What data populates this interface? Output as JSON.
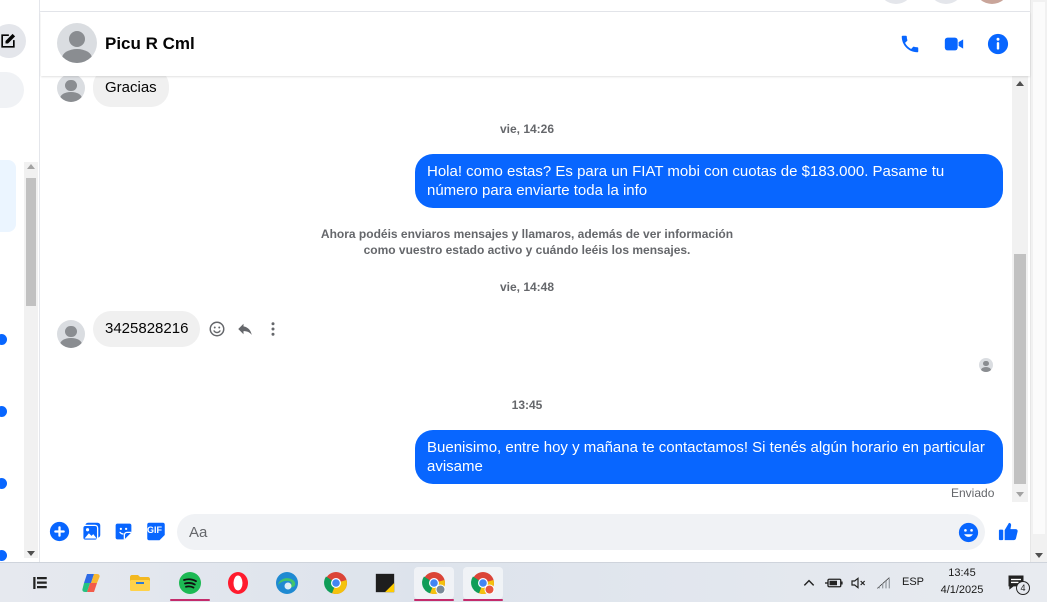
{
  "colors": {
    "accent": "#0866ff",
    "bubble_in": "#f0f0f0",
    "meta_text": "#65676b"
  },
  "header": {
    "contact_name": "Picu R Cml",
    "icons": [
      "phone-icon",
      "video-icon",
      "info-icon"
    ]
  },
  "messages": {
    "earlier_incoming": "Gracias",
    "timestamp_1": "vie, 14:26",
    "outgoing_1": "Hola! como estas? Es para un FIAT mobi con cuotas de $183.000. Pasame tu número para enviarte toda la info",
    "notice": "Ahora podéis enviaros mensajes y llamaros, además de ver información como vuestro estado activo y cuándo leéis los mensajes.",
    "timestamp_2": "vie, 14:48",
    "incoming_phone": "3425828216",
    "timestamp_3": "13:45",
    "outgoing_2": "Buenisimo, entre hoy y mañana te contactamos! Si tenés algún horario en particular avisame",
    "status": "Enviado"
  },
  "composer": {
    "placeholder": "Aa",
    "gif_label": "GIF",
    "icons": [
      "plus-icon",
      "image-icon",
      "sticker-icon",
      "gif-icon",
      "emoji-icon",
      "thumbs-up-icon"
    ]
  },
  "taskbar": {
    "apps": [
      "task-view-icon",
      "copilot-icon",
      "file-explorer-icon",
      "spotify-icon",
      "opera-icon",
      "edge-icon",
      "chrome-icon",
      "sticky-notes-icon",
      "chrome-profile-1-icon",
      "chrome-profile-2-icon"
    ],
    "language": "ESP",
    "time": "13:45",
    "date": "4/1/2025",
    "notifications": "4"
  }
}
